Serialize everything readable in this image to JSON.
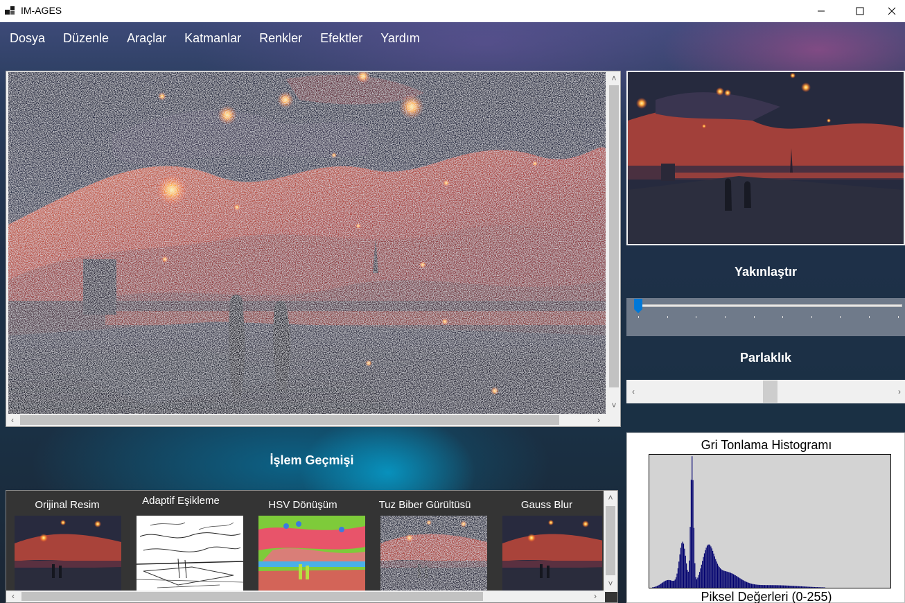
{
  "window": {
    "title": "IM-AGES"
  },
  "menu": [
    "Dosya",
    "Düzenle",
    "Araçlar",
    "Katmanlar",
    "Renkler",
    "Efektler",
    "Yardım"
  ],
  "controls": {
    "zoom_label": "Yakınlaştır",
    "zoom_value": 0.0,
    "brightness_label": "Parlaklık",
    "brightness_value": 0.5
  },
  "history": {
    "title": "İşlem Geçmişi",
    "items": [
      {
        "label": "Orijinal Resim",
        "style": "original"
      },
      {
        "label": "Adaptif Eşikleme",
        "style": "threshold"
      },
      {
        "label": "HSV Dönüşüm",
        "style": "hsv"
      },
      {
        "label": "Tuz Biber Gürültüsü",
        "style": "noise"
      },
      {
        "label": "Gauss Blur",
        "style": "blur"
      }
    ]
  },
  "histogram": {
    "title": "Gri Tonlama Histogramı",
    "xlabel": "Piksel Değerleri (0-255)"
  },
  "colors": {
    "titlebar": "#ffffff",
    "panel": "#f0f0f0",
    "histogram_bars": "#00006e",
    "histogram_bg": "#d3d3d3",
    "trackbar_thumb": "#0078d7"
  }
}
